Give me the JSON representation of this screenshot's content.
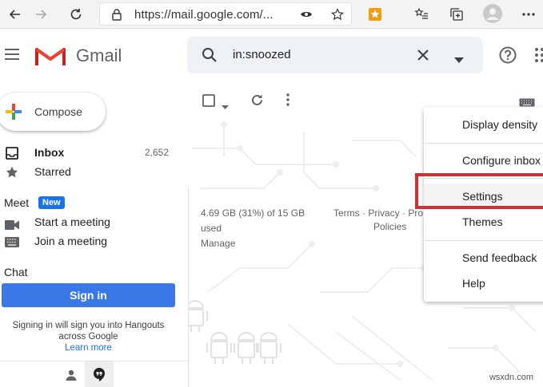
{
  "browser": {
    "url": "https://mail.google.com/...",
    "icons": [
      "back-arrow-icon",
      "forward-arrow-icon",
      "refresh-icon",
      "lock-icon",
      "tracking-icon",
      "favorite-star-icon",
      "extension-icon",
      "favorites-list-icon",
      "collections-icon",
      "profile-icon",
      "more-icon"
    ]
  },
  "header": {
    "app_name": "Gmail",
    "search_query": "in:snoozed"
  },
  "compose": {
    "label": "Compose"
  },
  "nav": {
    "items": [
      {
        "label": "Inbox",
        "count": "2,652",
        "bold": true
      },
      {
        "label": "Starred",
        "count": ""
      }
    ]
  },
  "meet": {
    "title": "Meet",
    "badge": "New",
    "items": [
      {
        "label": "Start a meeting",
        "icon": "video-camera-icon"
      },
      {
        "label": "Join a meeting",
        "icon": "keyboard-icon"
      }
    ]
  },
  "chat": {
    "title": "Chat",
    "signin_label": "Sign in",
    "info_line1": "Signing in will sign you into Hangouts",
    "info_line2": "across Google",
    "learn_more": "Learn more"
  },
  "storage": {
    "usage": "4.69 GB (31%) of 15 GB",
    "used": "used",
    "manage": "Manage"
  },
  "footer": {
    "links": "Terms · Privacy · Pro",
    "policies": "Policies"
  },
  "settings_menu": {
    "items": [
      "Display density",
      "Configure inbox",
      "Settings",
      "Themes",
      "Send feedback",
      "Help"
    ],
    "highlighted": "Settings"
  },
  "watermark": "wsxdn.com",
  "colors": {
    "accent": "#1a73e8",
    "signin_button": "#3b78e7",
    "highlight_box": "#d32f2f"
  }
}
